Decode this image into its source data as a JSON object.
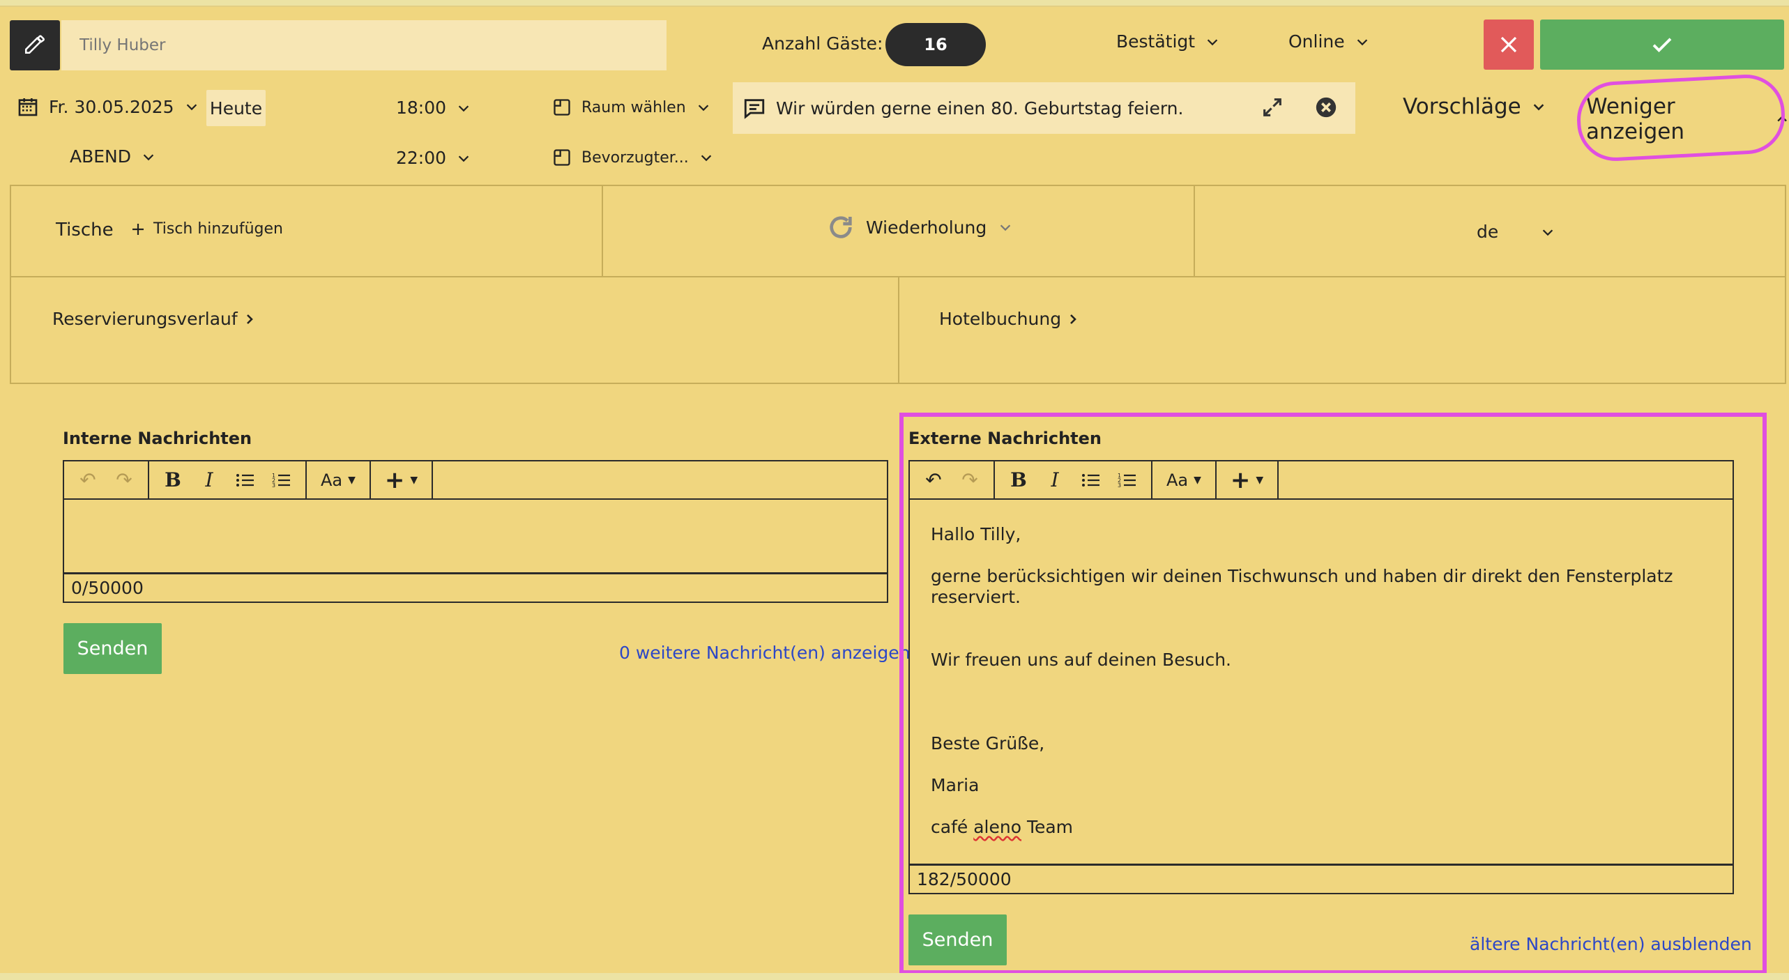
{
  "header": {
    "guest_name_placeholder": "Tilly Huber",
    "guests_label": "Anzahl Gäste:",
    "guests_count": "16",
    "status": "Bestätigt",
    "channel": "Online"
  },
  "booking": {
    "date": "Fr. 30.05.2025",
    "today_label": "Heute",
    "shift": "ABEND",
    "time_start": "18:00",
    "time_end": "22:00",
    "room": "Raum wählen",
    "preferred_room": "Bevorzugter...",
    "guest_message": "Wir würden gerne einen 80. Geburtstag feiern.",
    "suggestions": "Vorschläge",
    "show_less": "Weniger anzeigen"
  },
  "panels": {
    "tables_label": "Tische",
    "add_table": "Tisch hinzufügen",
    "repeat": "Wiederholung",
    "language": "de",
    "history": "Reservierungsverlauf",
    "hotel": "Hotelbuchung"
  },
  "internal": {
    "title": "Interne Nachrichten",
    "counter": "0/50000",
    "send": "Senden",
    "more_link": "0 weitere Nachricht(en) anzeigen",
    "font_label": "Aa"
  },
  "external": {
    "title": "Externe Nachrichten",
    "counter": "182/50000",
    "send": "Senden",
    "hide_link": "ältere Nachricht(en) ausblenden",
    "font_label": "Aa",
    "lines": {
      "l1": "Hallo Tilly,",
      "l2": "gerne berücksichtigen wir deinen Tischwunsch und haben dir direkt den Fensterplatz reserviert.",
      "l3": "Wir freuen uns auf deinen Besuch.",
      "l4": "Beste Grüße,",
      "l5": "Maria",
      "l6a": "café ",
      "l6b": "aleno",
      "l6c": " Team"
    }
  },
  "colors": {
    "background": "#f0d67f",
    "accent_green": "#5cae5f",
    "cancel_red": "#e15a5a",
    "highlight": "#e04fe0",
    "link_blue": "#2c47c7"
  }
}
